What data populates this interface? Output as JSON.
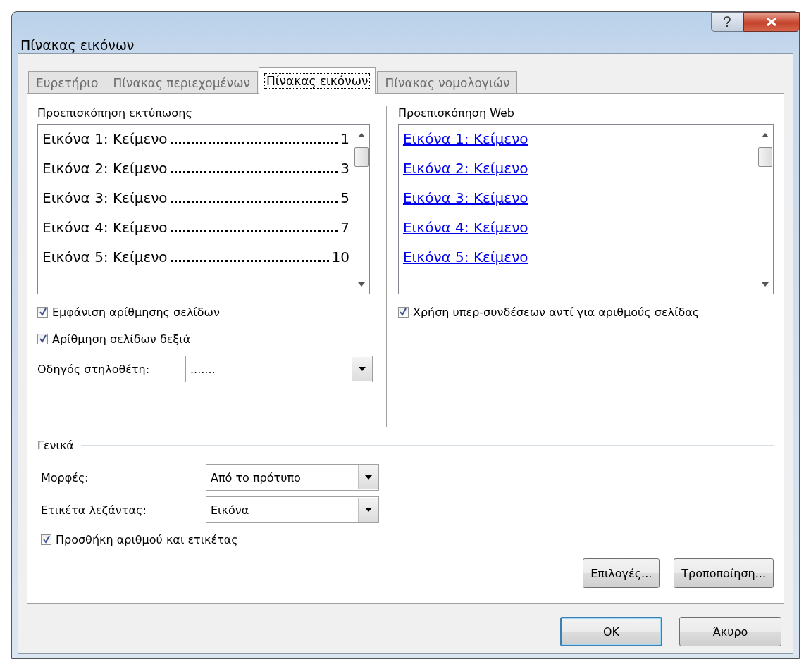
{
  "window": {
    "title": "Πίνακας εικόνων"
  },
  "tabs": [
    {
      "label": "Ευρετήριο",
      "selected": false
    },
    {
      "label": "Πίνακας περιεχομένων",
      "selected": false
    },
    {
      "label": "Πίνακας εικόνων",
      "selected": true
    },
    {
      "label": "Πίνακας νομολογιών",
      "selected": false
    }
  ],
  "print_preview": {
    "label": "Προεπισκόπηση εκτύπωσης",
    "entries": [
      {
        "text": "Εικόνα 1: Κείμενο",
        "page": "1"
      },
      {
        "text": "Εικόνα 2: Κείμενο",
        "page": "3"
      },
      {
        "text": "Εικόνα 3: Κείμενο",
        "page": "5"
      },
      {
        "text": "Εικόνα 4: Κείμενο",
        "page": "7"
      },
      {
        "text": "Εικόνα 5: Κείμενο",
        "page": "10"
      }
    ],
    "options": [
      {
        "label": "Εμφάνιση αρίθμησης σελίδων",
        "checked": true
      },
      {
        "label": "Αρίθμηση σελίδων δεξιά",
        "checked": true
      }
    ],
    "tab_leader": {
      "label": "Οδηγός στηλοθέτη:",
      "value": "......."
    }
  },
  "web_preview": {
    "label": "Προεπισκόπηση Web",
    "links": [
      "Εικόνα 1: Κείμενο",
      "Εικόνα 2: Κείμενο",
      "Εικόνα 3: Κείμενο",
      "Εικόνα 4: Κείμενο",
      "Εικόνα 5: Κείμενο"
    ],
    "options": [
      {
        "label": "Χρήση υπερ-συνδέσεων αντί για αριθμούς σελίδας",
        "checked": true
      }
    ]
  },
  "general": {
    "label": "Γενικά",
    "fields": [
      {
        "label": "Μορφές:",
        "value": "Από το πρότυπο"
      },
      {
        "label": "Ετικέτα λεζάντας:",
        "value": "Εικόνα"
      }
    ],
    "options": [
      {
        "label": "Προσθήκη αριθμού και ετικέτας",
        "checked": true
      }
    ],
    "buttons": [
      "Επιλογές...",
      "Τροποποίηση..."
    ]
  },
  "buttons": [
    {
      "label": "OK",
      "default": true
    },
    {
      "label": "Άκυρο",
      "default": false
    }
  ]
}
